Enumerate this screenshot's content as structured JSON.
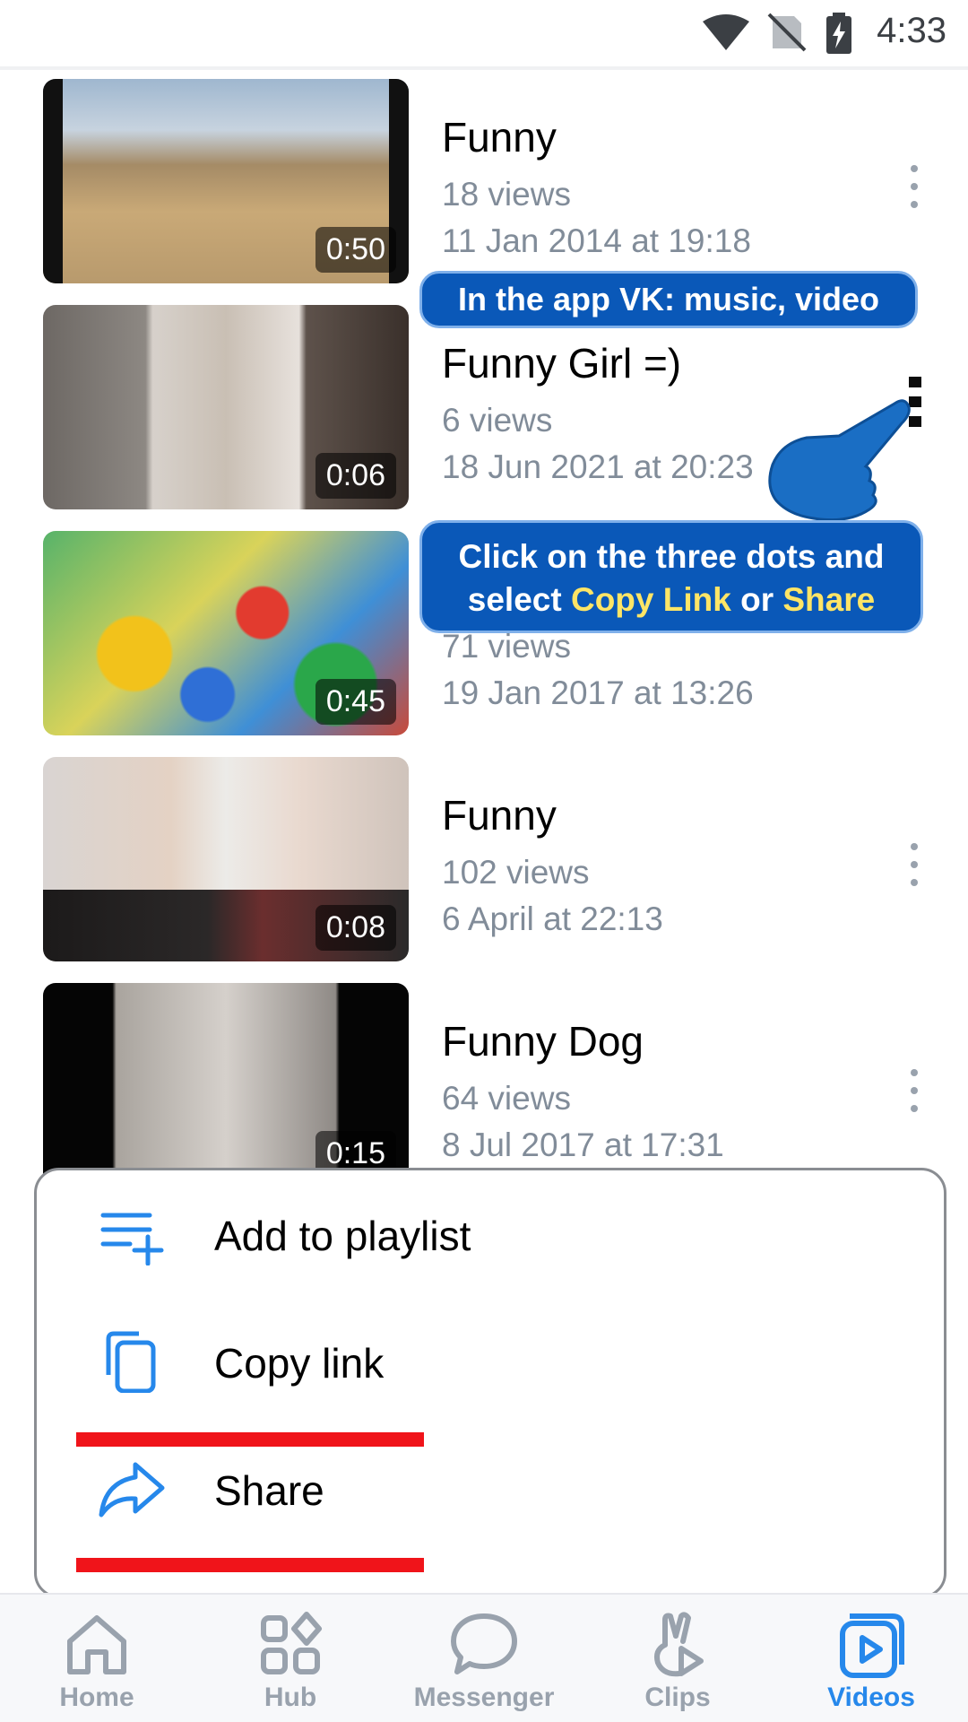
{
  "status_bar": {
    "time": "4:33",
    "icons": [
      "wifi-icon",
      "no-sim-icon",
      "battery-charging-icon"
    ]
  },
  "videos": [
    {
      "title": "Funny",
      "views": "18 views",
      "date": "11 Jan 2014 at 19:18",
      "duration": "0:50"
    },
    {
      "title": "Funny Girl =)",
      "views": "6 views",
      "date": "18 Jun 2021 at 20:23",
      "duration": "0:06"
    },
    {
      "title": "",
      "views": "71 views",
      "date": "19 Jan 2017 at 13:26",
      "duration": "0:45"
    },
    {
      "title": "Funny",
      "views": "102 views",
      "date": "6 April at 22:13",
      "duration": "0:08"
    },
    {
      "title": "Funny Dog",
      "views": "64 views",
      "date": "8 Jul 2017 at 17:31",
      "duration": "0:15"
    }
  ],
  "overlay": {
    "banner": "In the app VK: music, video",
    "instruction_line1": "Click on the three dots and",
    "instruction_select": "select ",
    "instruction_copy": "Copy Link",
    "instruction_or": " or ",
    "instruction_share": "Share"
  },
  "sheet": {
    "items": [
      {
        "label": "Add to playlist",
        "icon": "add-to-playlist-icon"
      },
      {
        "label": "Copy link",
        "icon": "copy-icon"
      },
      {
        "label": "Share",
        "icon": "share-icon"
      }
    ]
  },
  "tabs": [
    {
      "label": "Home",
      "icon": "home-icon",
      "active": false
    },
    {
      "label": "Hub",
      "icon": "hub-icon",
      "active": false
    },
    {
      "label": "Messenger",
      "icon": "messenger-icon",
      "active": false
    },
    {
      "label": "Clips",
      "icon": "clips-icon",
      "active": false
    },
    {
      "label": "Videos",
      "icon": "videos-icon",
      "active": true
    }
  ],
  "colors": {
    "accent": "#2688eb",
    "callout_bg": "#0a58b8",
    "highlight": "#ffe566",
    "underline": "#f0141a",
    "secondary_text": "#818c99"
  }
}
